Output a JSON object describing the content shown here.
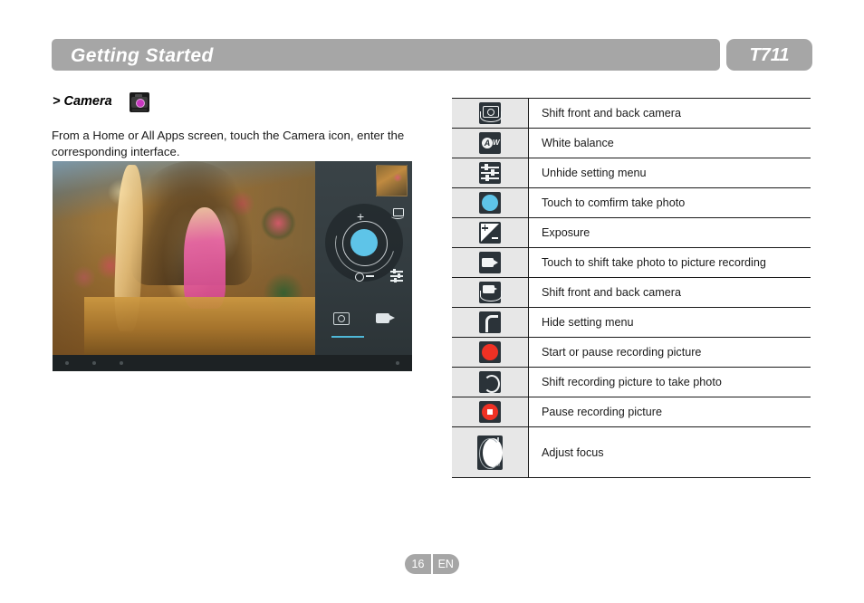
{
  "header": {
    "title": "Getting Started",
    "model": "T711"
  },
  "left": {
    "section_heading": "> Camera",
    "app_icon_name": "camera-app-icon",
    "paragraph": "From a Home or All Apps screen, touch the Camera icon, enter the corresponding interface.",
    "screenshot": {
      "name": "camera-interface-screenshot",
      "panel_glyphs": {
        "plus": "+",
        "minus": "—"
      }
    }
  },
  "table": {
    "rows": [
      {
        "icon": "flip-camera-icon",
        "desc": "Shift front and back camera"
      },
      {
        "icon": "auto-white-balance-icon",
        "desc": "White balance"
      },
      {
        "icon": "settings-sliders-icon",
        "desc": "Unhide setting menu"
      },
      {
        "icon": "shutter-button-icon",
        "desc": "Touch to comfirm take photo"
      },
      {
        "icon": "exposure-icon",
        "desc": "Exposure"
      },
      {
        "icon": "video-camera-icon",
        "desc": "Touch to shift take photo to picture recording"
      },
      {
        "icon": "flip-video-camera-icon",
        "desc": "Shift front and back camera"
      },
      {
        "icon": "hide-menu-icon",
        "desc": "Hide setting menu"
      },
      {
        "icon": "record-button-icon",
        "desc": "Start or pause recording picture"
      },
      {
        "icon": "back-to-photo-icon",
        "desc": "Shift recording picture to take photo"
      },
      {
        "icon": "pause-recording-icon",
        "desc": "Pause recording picture"
      },
      {
        "icon": "adjust-focus-icon",
        "desc": "Adjust focus"
      }
    ]
  },
  "footer": {
    "page": "16",
    "language": "EN"
  },
  "colors": {
    "header_gray": "#a6a6a6",
    "icon_cell_gray": "#e7e7e7",
    "rule_dark": "#1a1a1a",
    "accent_cyan": "#5ec4e8",
    "accent_red": "#ef3124",
    "icon_tile_dark": "#2b3339"
  }
}
